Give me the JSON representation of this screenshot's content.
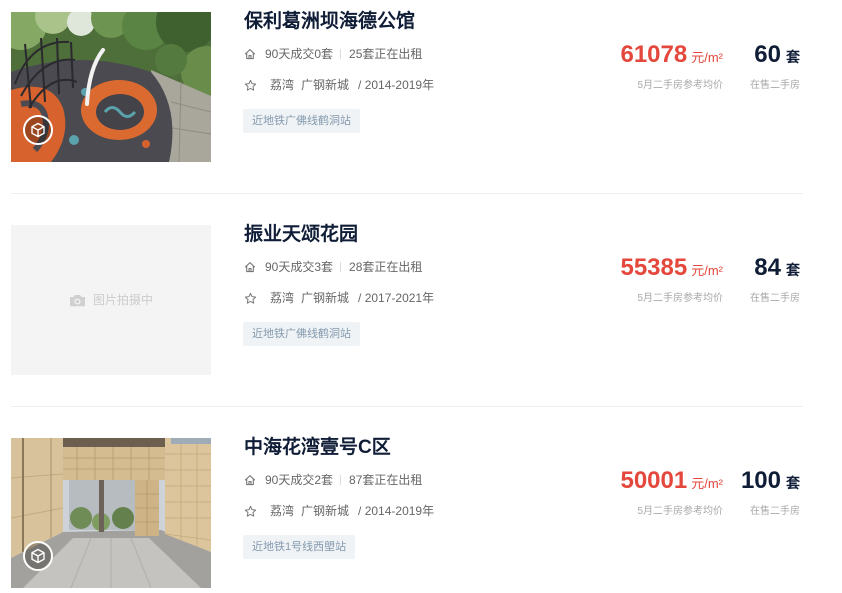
{
  "colors": {
    "title": "#101d37",
    "price": "#e4473c",
    "meta_text": "#666666",
    "sub_text": "#a8a8a8",
    "tag_bg": "#eff3f6",
    "tag_text": "#8499ad",
    "divider": "#eeeeee",
    "placeholder_bg": "#f4f4f4"
  },
  "listings": [
    {
      "photo": {
        "badge_icon": "vr-icon"
      },
      "title": "保利葛洲坝海德公馆",
      "deals_icon": "house-icon",
      "deals_90d": "90天成交0套",
      "renting": "25套正在出租",
      "location_icon": "star-icon",
      "district": "荔湾",
      "bizcircle": "广钢新城",
      "build_years": "/ 2014-2019年",
      "tag": "近地铁广佛线鹤洞站",
      "price": "61078",
      "price_unit": "元/m²",
      "price_desc": "5月二手房参考均价",
      "on_sale_count": "60",
      "on_sale_unit": "套",
      "on_sale_desc": "在售二手房"
    },
    {
      "photo": {
        "placeholder_icon": "camera-icon",
        "placeholder_text": "图片拍摄中"
      },
      "title": "振业天颂花园",
      "deals_icon": "house-icon",
      "deals_90d": "90天成交3套",
      "renting": "28套正在出租",
      "location_icon": "star-icon",
      "district": "荔湾",
      "bizcircle": "广钢新城",
      "build_years": "/ 2017-2021年",
      "tag": "近地铁广佛线鹤洞站",
      "price": "55385",
      "price_unit": "元/m²",
      "price_desc": "5月二手房参考均价",
      "on_sale_count": "84",
      "on_sale_unit": "套",
      "on_sale_desc": "在售二手房"
    },
    {
      "photo": {
        "badge_icon": "vr-icon"
      },
      "title": "中海花湾壹号C区",
      "deals_icon": "house-icon",
      "deals_90d": "90天成交2套",
      "renting": "87套正在出租",
      "location_icon": "star-icon",
      "district": "荔湾",
      "bizcircle": "广钢新城",
      "build_years": "/ 2014-2019年",
      "tag": "近地铁1号线西塱站",
      "price": "50001",
      "price_unit": "元/m²",
      "price_desc": "5月二手房参考均价",
      "on_sale_count": "100",
      "on_sale_unit": "套",
      "on_sale_desc": "在售二手房"
    }
  ]
}
